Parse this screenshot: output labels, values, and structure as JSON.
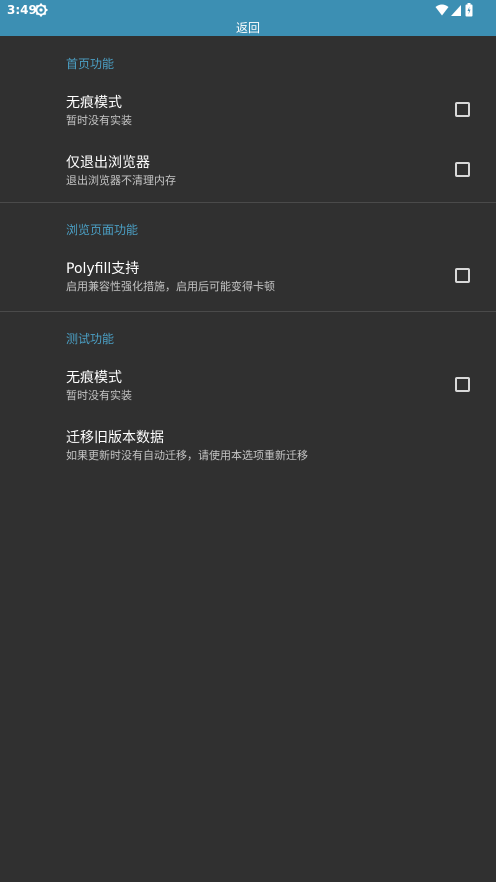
{
  "status_bar": {
    "time": "3:49",
    "icons": [
      "gear-icon",
      "wifi-icon",
      "signal-icon",
      "battery-icon"
    ]
  },
  "header": {
    "title": "返回"
  },
  "sections": [
    {
      "title": "首页功能",
      "items": [
        {
          "title": "无痕模式",
          "summary": "暂时没有实装",
          "checkbox": true,
          "checked": false
        },
        {
          "title": "仅退出浏览器",
          "summary": "退出浏览器不清理内存",
          "checkbox": true,
          "checked": false
        }
      ]
    },
    {
      "title": "浏览页面功能",
      "items": [
        {
          "title": "Polyfill支持",
          "summary": "启用兼容性强化措施，启用后可能变得卡顿",
          "checkbox": true,
          "checked": false
        }
      ]
    },
    {
      "title": "测试功能",
      "items": [
        {
          "title": "无痕模式",
          "summary": "暂时没有实装",
          "checkbox": true,
          "checked": false
        },
        {
          "title": "迁移旧版本数据",
          "summary": "如果更新时没有自动迁移，请使用本选项重新迁移",
          "checkbox": false
        }
      ]
    }
  ],
  "colors": {
    "header_bg": "#3c8fb3",
    "background": "#303030",
    "category_text": "#4b9fc4",
    "divider": "#4a4a4a"
  }
}
